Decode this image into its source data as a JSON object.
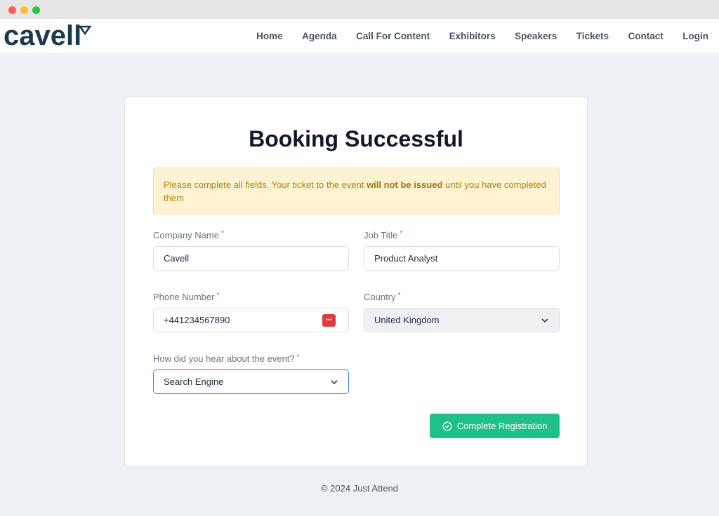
{
  "brand": {
    "logo": "cavell"
  },
  "nav": {
    "items": [
      "Home",
      "Agenda",
      "Call For Content",
      "Exhibitors",
      "Speakers",
      "Tickets",
      "Contact",
      "Login"
    ]
  },
  "main": {
    "title": "Booking Successful",
    "alert": {
      "before": "Please complete all fields. Your ticket to the event ",
      "bold": "will not be issued",
      "after": " until you have completed them"
    },
    "fields": {
      "company": {
        "label": "Company Name",
        "value": "Cavell"
      },
      "job": {
        "label": "Job Title",
        "value": "Product Analyst"
      },
      "phone": {
        "label": "Phone Number",
        "value": "+441234567890"
      },
      "country": {
        "label": "Country",
        "value": "United Kingdom"
      },
      "source": {
        "label": "How did you hear about the event?",
        "value": "Search Engine"
      }
    },
    "required_mark": "*",
    "submit": "Complete Registration"
  },
  "footer": "© 2024 Just Attend",
  "colors": {
    "brand": "#1b3a4b",
    "accent": "#20c08a",
    "alert_bg": "#fdf3d3"
  }
}
